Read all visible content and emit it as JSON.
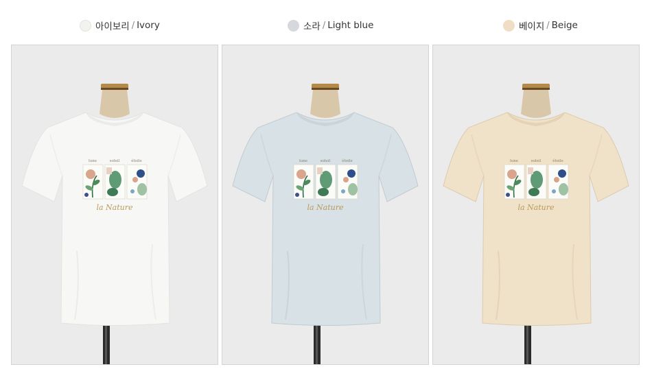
{
  "variants": [
    {
      "name_ko": "아이보리",
      "separator": "/",
      "name_en": "Ivory",
      "swatch": "#f2f2ef",
      "shirt": "#f7f8f6",
      "shade": "#e3e4e1",
      "bg": "#ebebeb"
    },
    {
      "name_ko": "소라",
      "separator": "/",
      "name_en": "Light blue",
      "swatch": "#d5d8dc",
      "shirt": "#d8e1e5",
      "shade": "#c1cbd0",
      "bg": "#ebebeb"
    },
    {
      "name_ko": "베이지",
      "separator": "/",
      "name_en": "Beige",
      "swatch": "#efddc4",
      "shirt": "#f0e2c8",
      "shade": "#ddcaac",
      "bg": "#ebebeb"
    }
  ],
  "print": {
    "words": [
      "lune",
      "soleil",
      "étoile"
    ],
    "script": "la Nature"
  }
}
